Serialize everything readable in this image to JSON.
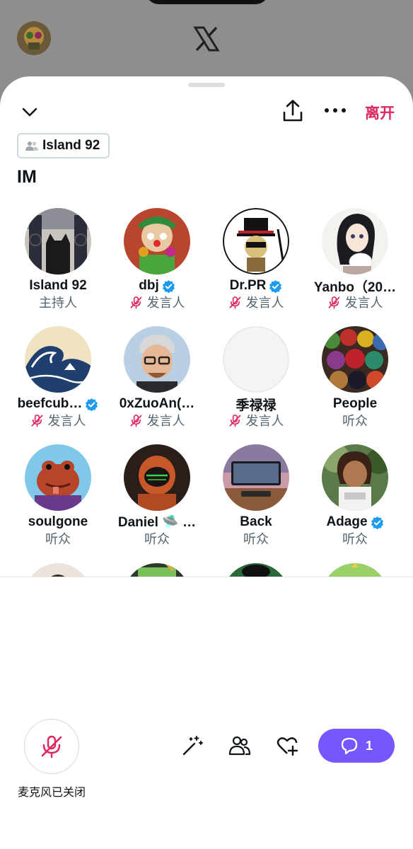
{
  "background_app": {
    "logo_icon": "x-logo-icon"
  },
  "header": {
    "leave_label": "离开",
    "collapse_icon": "chevron-down-icon",
    "share_icon": "share-icon",
    "more_icon": "more-icon"
  },
  "community": {
    "label": "Island 92",
    "icon": "people-icon"
  },
  "space": {
    "title": "IM"
  },
  "participants": [
    {
      "name": "Island 92",
      "role": "主持人",
      "verified": false,
      "muted": false
    },
    {
      "name": "dbj",
      "role": "发言人",
      "verified": true,
      "muted": true
    },
    {
      "name": "Dr.PR",
      "role": "发言人",
      "verified": true,
      "muted": true
    },
    {
      "name": "Yanbo（20…",
      "role": "发言人",
      "verified": false,
      "muted": true
    },
    {
      "name": "beefcub…",
      "role": "发言人",
      "verified": true,
      "muted": true
    },
    {
      "name": "0xZuoAn(…",
      "role": "发言人",
      "verified": false,
      "muted": true
    },
    {
      "name": "季禄禄",
      "role": "发言人",
      "verified": false,
      "muted": true
    },
    {
      "name": "People",
      "role": "听众",
      "verified": false,
      "muted": false
    },
    {
      "name": "soulgone",
      "role": "听众",
      "verified": false,
      "muted": false
    },
    {
      "name": "Daniel 🛸 …",
      "role": "听众",
      "verified": false,
      "muted": false
    },
    {
      "name": "Back",
      "role": "听众",
      "verified": false,
      "muted": false
    },
    {
      "name": "Adage",
      "role": "听众",
      "verified": true,
      "muted": false
    }
  ],
  "footer": {
    "mic_label": "麦克风已关闭",
    "mic_icon": "mic-off-icon",
    "chat_count": "1",
    "tools": [
      "magic-wand-icon",
      "people-icon",
      "heart-plus-icon",
      "chat-bubble-icon"
    ]
  },
  "colors": {
    "accent": "#7856ff",
    "leave": "#e0245e",
    "verified": "#1d9bf0",
    "muted_icon": "#e0245e",
    "secondary_text": "#536471"
  }
}
